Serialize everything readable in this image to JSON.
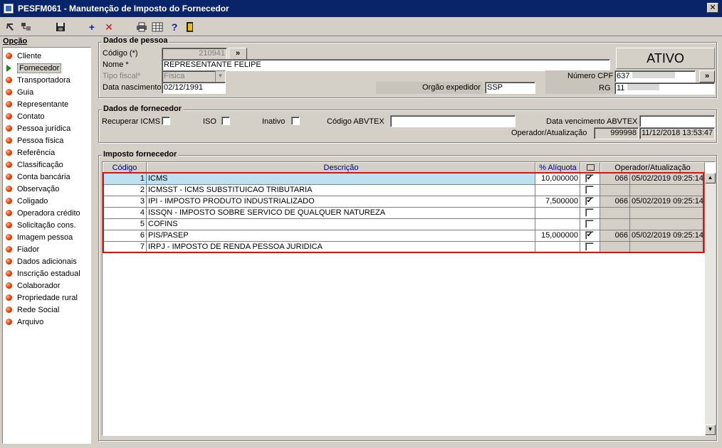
{
  "window": {
    "title": "PESFM061 - Manutenção de Imposto do Fornecedor",
    "close_label": "✕"
  },
  "toolbar": {
    "items": [
      "back-icon",
      "tree-icon",
      "save-icon",
      "add-icon",
      "delete-icon",
      "print-icon",
      "grid-icon",
      "help-icon",
      "exit-icon"
    ]
  },
  "opcao": {
    "title": "Opção",
    "items": [
      "Cliente",
      "Fornecedor",
      "Transportadora",
      "Guia",
      "Representante",
      "Contato",
      "Pessoa jurídica",
      "Pessoa física",
      "Referência",
      "Classificação",
      "Conta bancária",
      "Observação",
      "Coligado",
      "Operadora crédito",
      "Solicitação cons.",
      "Imagem pessoa",
      "Fiador",
      "Dados adicionais",
      "Inscrição estadual",
      "Colaborador",
      "Propriedade rural",
      "Rede Social",
      "Arquivo"
    ],
    "selected": "Fornecedor"
  },
  "pessoa": {
    "title": "Dados de pessoa",
    "codigo_label": "Código (*)",
    "codigo_value": "210941",
    "nome_label": "Nome *",
    "nome_value": "REPRESENTANTE FELIPE",
    "tipo_label": "Tipo fiscal*",
    "tipo_value": "Física",
    "nascimento_label": "Data nascimento",
    "nascimento_value": "02/12/1991",
    "orgao_label": "Orgão expedidor",
    "orgao_value": "SSP",
    "cpf_label": "Número CPF",
    "cpf_value": "637",
    "rg_label": "RG",
    "rg_value": "11",
    "status": "ATIVO",
    "lookup_label": "»"
  },
  "fornecedor": {
    "title": "Dados de fornecedor",
    "icms_label": "Recuperar ICMS",
    "iso_label": "ISO",
    "inativo_label": "Inativo",
    "abvtex_label": "Código ABVTEX",
    "abvtex_value": "",
    "venc_label": "Data vencimento ABVTEX",
    "venc_value": "",
    "oper_label": "Operador/Atualização",
    "oper_code": "999998",
    "oper_date": "11/12/2018 13:53:47"
  },
  "imposto": {
    "title": "Imposto fornecedor",
    "headers": {
      "codigo": "Código",
      "descricao": "Descrição",
      "aliquota": "% Alíquota",
      "operador": "Operador/Atualização"
    },
    "rows": [
      {
        "codigo": "1",
        "descricao": "ICMS",
        "aliquota": "10,000000",
        "checked": "✔",
        "operador": "066",
        "data": "05/02/2019 09:25:14"
      },
      {
        "codigo": "2",
        "descricao": "ICMSST - ICMS SUBSTITUICAO TRIBUTARIA",
        "aliquota": "",
        "checked": "",
        "operador": "",
        "data": ""
      },
      {
        "codigo": "3",
        "descricao": "IPI - IMPOSTO PRODUTO INDUSTRIALIZADO",
        "aliquota": "7,500000",
        "checked": "✔",
        "operador": "066",
        "data": "05/02/2019 09:25:14"
      },
      {
        "codigo": "4",
        "descricao": "ISSQN - IMPOSTO SOBRE SERVICO DE QUALQUER NATUREZA",
        "aliquota": "",
        "checked": "",
        "operador": "",
        "data": ""
      },
      {
        "codigo": "5",
        "descricao": "COFINS",
        "aliquota": "",
        "checked": "",
        "operador": "",
        "data": ""
      },
      {
        "codigo": "6",
        "descricao": "PIS/PASEP",
        "aliquota": "15,000000",
        "checked": "✔",
        "operador": "066",
        "data": "05/02/2019 09:25:14"
      },
      {
        "codigo": "7",
        "descricao": "IRPJ - IMPOSTO DE RENDA PESSOA JURIDICA",
        "aliquota": "",
        "checked": "",
        "operador": "",
        "data": ""
      }
    ]
  },
  "colors": {
    "titlebar": "#0a246a",
    "highlight": "#e01010",
    "selected_row": "#bfe0ef"
  }
}
